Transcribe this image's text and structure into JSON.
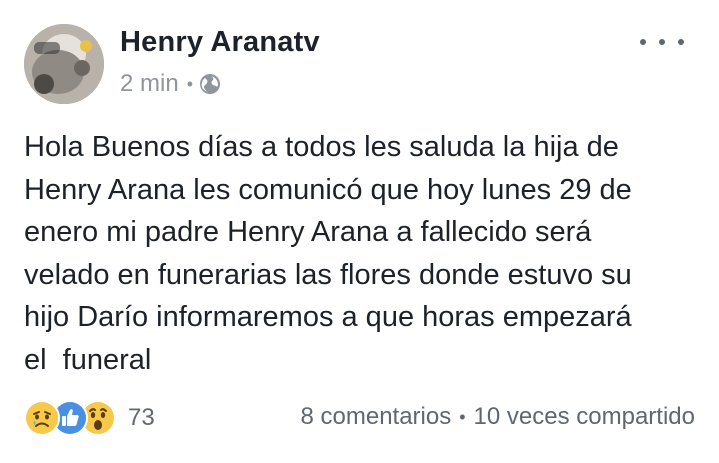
{
  "post": {
    "author": "Henry Aranatv",
    "time": "2 min",
    "meta_separator": "•",
    "privacy_icon": "globe-icon",
    "more_icon": "more-options-icon",
    "text": "Hola Buenos días a todos les saluda la hija de\nHenry Arana les comunicó que hoy lunes 29 de\nenero mi padre Henry Arana a fallecido será\nvelado en funerarias las flores donde estuvo su\nhijo Darío informaremos a que horas empezará\nel  funeral"
  },
  "footer": {
    "reactions": [
      "sad-reaction-icon",
      "like-reaction-icon",
      "wow-reaction-icon"
    ],
    "reaction_count": "73",
    "comments": "8 comentarios",
    "separator": "•",
    "shares": "10 veces compartido"
  },
  "colors": {
    "text": "#1d2129",
    "secondary": "#90949c",
    "like_blue": "#4a90e2",
    "reaction_yellow": "#f7c94b"
  }
}
